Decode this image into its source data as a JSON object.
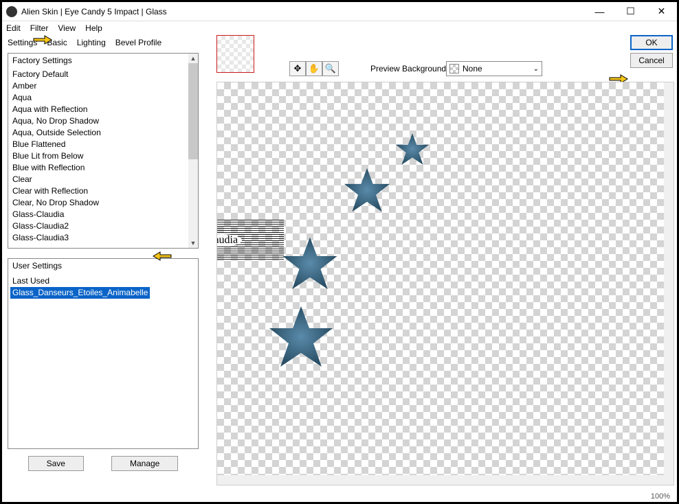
{
  "titlebar": {
    "text": "Alien Skin | Eye Candy 5 Impact | Glass"
  },
  "menubar": {
    "edit": "Edit",
    "filter": "Filter",
    "view": "View",
    "help": "Help"
  },
  "tabs": {
    "settings": "Settings",
    "basic": "Basic",
    "lighting": "Lighting",
    "bevel": "Bevel Profile"
  },
  "factory": {
    "header": "Factory Settings",
    "items": [
      "Factory Default",
      "Amber",
      "Aqua",
      "Aqua with Reflection",
      "Aqua, No Drop Shadow",
      "Aqua, Outside Selection",
      "Blue Flattened",
      "Blue Lit from Below",
      "Blue with Reflection",
      "Clear",
      "Clear with Reflection",
      "Clear, No Drop Shadow",
      "Glass-Claudia",
      "Glass-Claudia2",
      "Glass-Claudia3"
    ]
  },
  "user": {
    "header": "User Settings",
    "last_used": "Last Used",
    "selected": "Glass_Danseurs_Etoiles_Animabelle"
  },
  "buttons": {
    "save": "Save",
    "manage": "Manage",
    "ok": "OK",
    "cancel": "Cancel"
  },
  "preview": {
    "label": "Preview Background:",
    "value": "None"
  },
  "watermark": "claudia",
  "zoom": "100%"
}
